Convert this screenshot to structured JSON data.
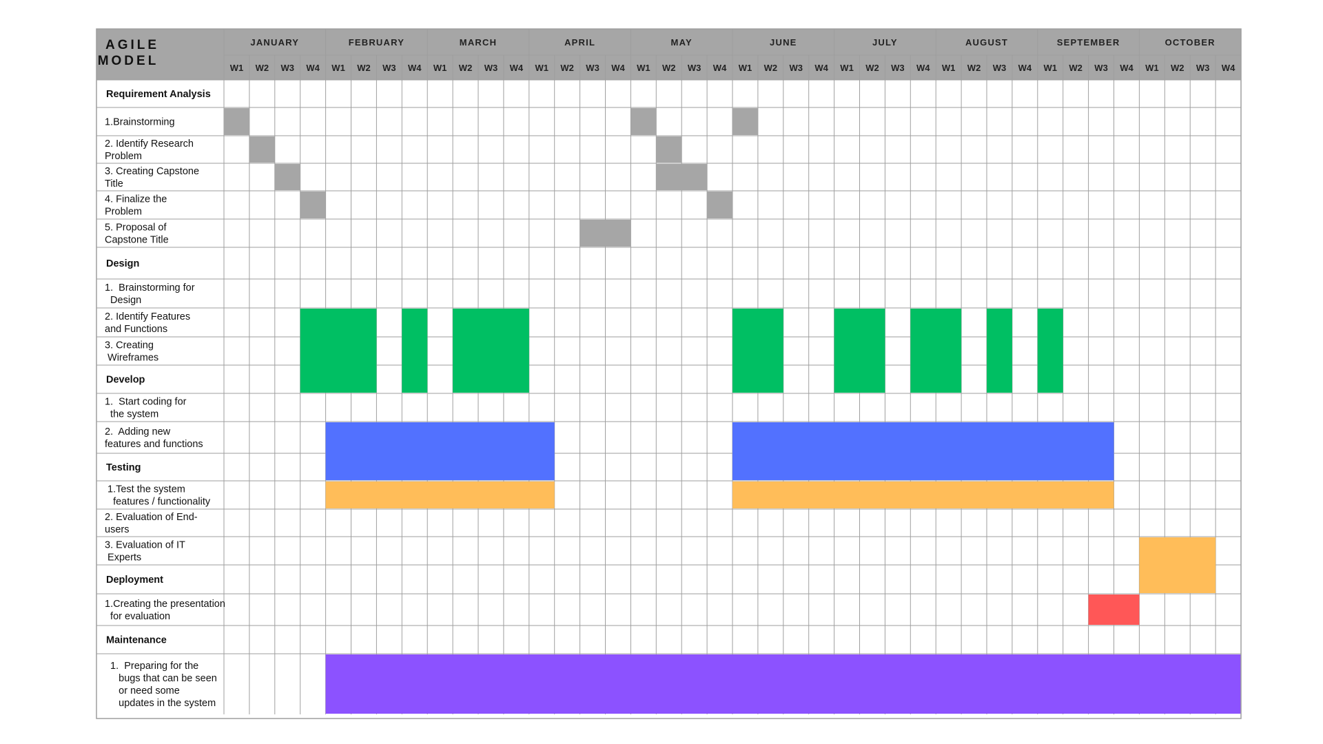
{
  "chart_data": {
    "type": "gantt",
    "title": "AGILE MODEL",
    "months": [
      "JANUARY",
      "FEBRUARY",
      "MARCH",
      "APRIL",
      "MAY",
      "JUNE",
      "JULY",
      "AUGUST",
      "SEPTEMBER",
      "OCTOBER"
    ],
    "weeks": [
      "W1",
      "W2",
      "W3",
      "W4"
    ],
    "colors": {
      "header": "#a6a6a6",
      "grid": "#9e9e9e",
      "requirement": "#a6a6a6",
      "design": "#00bf63",
      "develop": "#5271ff",
      "testing": "#ffbd59",
      "deployment": "#ff5757",
      "maintenance": "#8c52ff"
    },
    "rows": [
      {
        "type": "section",
        "label": "Requirement Analysis"
      },
      {
        "type": "task",
        "lines": [
          "1.Brainstorming"
        ],
        "color": "requirement",
        "spans": [
          [
            1,
            1
          ],
          [
            17,
            17
          ],
          [
            21,
            21
          ]
        ]
      },
      {
        "type": "task",
        "lines": [
          "2. Identify Research",
          "Problem"
        ],
        "color": "requirement",
        "spans": [
          [
            2,
            2
          ],
          [
            18,
            18
          ]
        ]
      },
      {
        "type": "task",
        "lines": [
          "3. Creating Capstone",
          "Title"
        ],
        "color": "requirement",
        "spans": [
          [
            3,
            3
          ],
          [
            18,
            19
          ]
        ]
      },
      {
        "type": "task",
        "lines": [
          "4. Finalize the",
          "Problem"
        ],
        "color": "requirement",
        "spans": [
          [
            4,
            4
          ],
          [
            20,
            20
          ]
        ]
      },
      {
        "type": "task",
        "lines": [
          "5. Proposal of",
          "Capstone Title"
        ],
        "color": "requirement",
        "spans": [
          [
            15,
            16
          ]
        ]
      },
      {
        "type": "section",
        "label": "Design"
      },
      {
        "type": "task",
        "lines": [
          "1.  Brainstorming for",
          "  Design"
        ],
        "color": "design",
        "spans": []
      },
      {
        "type": "task",
        "lines": [
          "2. Identify Features",
          "and Functions"
        ],
        "color": "design",
        "spans": []
      },
      {
        "type": "task",
        "lines": [
          "3. Creating",
          " Wireframes"
        ],
        "color": "design",
        "spans": []
      },
      {
        "type": "section",
        "label": "Develop"
      },
      {
        "type": "task",
        "lines": [
          "1.  Start coding for",
          "  the system"
        ],
        "color": "develop",
        "spans": []
      },
      {
        "type": "task",
        "lines": [
          "2.  Adding new",
          "features and functions"
        ],
        "color": "develop",
        "spans": []
      },
      {
        "type": "section",
        "label": "Testing"
      },
      {
        "type": "task",
        "lines": [
          " 1.Test the system",
          "   features / functionality"
        ],
        "color": "testing",
        "spans": [
          [
            5,
            13
          ],
          [
            21,
            35
          ]
        ]
      },
      {
        "type": "task",
        "lines": [
          "2. Evaluation of End-",
          "users"
        ],
        "color": "testing",
        "spans": []
      },
      {
        "type": "task",
        "lines": [
          "3. Evaluation of IT",
          " Experts"
        ],
        "color": "testing",
        "spans": []
      },
      {
        "type": "section",
        "label": "Deployment"
      },
      {
        "type": "task",
        "lines": [
          "1.Creating the presentation",
          "  for evaluation"
        ],
        "color": "deployment",
        "spans": [
          [
            35,
            36
          ]
        ]
      },
      {
        "type": "section",
        "label": "Maintenance"
      },
      {
        "type": "task",
        "lines": [
          "  1.  Preparing for the",
          "     bugs that can be seen",
          "     or need some",
          "     updates in the system"
        ],
        "color": "maintenance",
        "spans": [
          [
            5,
            40
          ]
        ]
      }
    ],
    "merged_spans": [
      {
        "rows": [
          8,
          10
        ],
        "weeks": [
          4,
          6
        ],
        "color": "design"
      },
      {
        "rows": [
          8,
          10
        ],
        "weeks": [
          8,
          8
        ],
        "color": "design"
      },
      {
        "rows": [
          8,
          10
        ],
        "weeks": [
          10,
          12
        ],
        "color": "design"
      },
      {
        "rows": [
          8,
          10
        ],
        "weeks": [
          21,
          22
        ],
        "color": "design"
      },
      {
        "rows": [
          8,
          10
        ],
        "weeks": [
          25,
          26
        ],
        "color": "design"
      },
      {
        "rows": [
          8,
          10
        ],
        "weeks": [
          28,
          29
        ],
        "color": "design"
      },
      {
        "rows": [
          8,
          10
        ],
        "weeks": [
          31,
          31
        ],
        "color": "design"
      },
      {
        "rows": [
          8,
          10
        ],
        "weeks": [
          33,
          33
        ],
        "color": "design"
      },
      {
        "rows": [
          12,
          13
        ],
        "weeks": [
          5,
          13
        ],
        "color": "develop"
      },
      {
        "rows": [
          12,
          13
        ],
        "weeks": [
          21,
          35
        ],
        "color": "develop"
      },
      {
        "rows": [
          16,
          17
        ],
        "weeks": [
          37,
          39
        ],
        "color": "testing"
      }
    ]
  }
}
